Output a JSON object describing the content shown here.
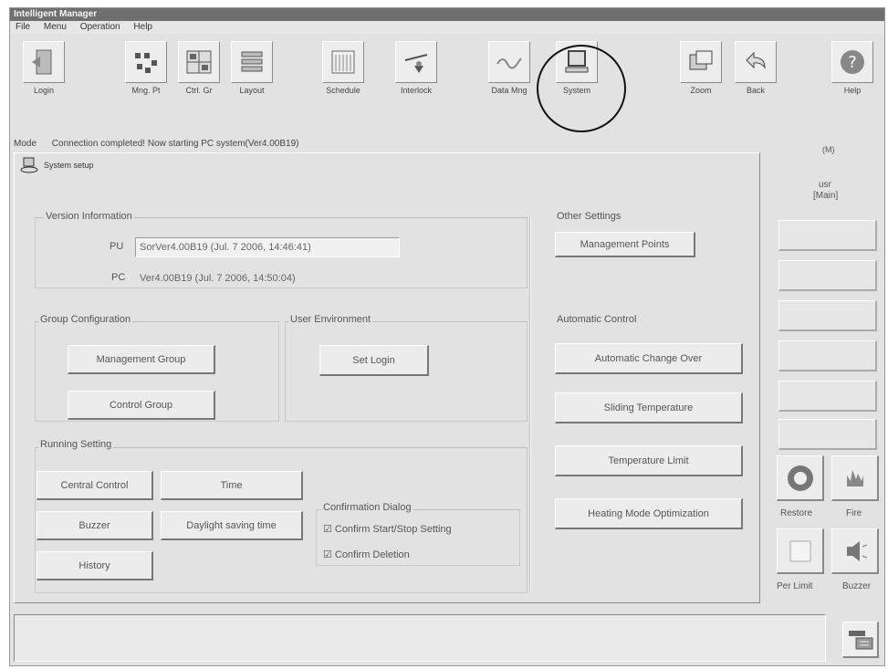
{
  "window": {
    "title": "Intelligent Manager"
  },
  "menu": [
    "File",
    "Menu",
    "Operation",
    "Help"
  ],
  "toolbar": [
    {
      "label": "Login",
      "icon": "door-icon"
    },
    {
      "label": "Mng. Pt",
      "icon": "network-icon"
    },
    {
      "label": "Ctrl. Gr",
      "icon": "grid-icon"
    },
    {
      "label": "Layout",
      "icon": "layers-icon"
    },
    {
      "label": "Schedule",
      "icon": "calendar-icon"
    },
    {
      "label": "Interlock",
      "icon": "interlock-icon"
    },
    {
      "label": "Data Mng",
      "icon": "wave-icon"
    },
    {
      "label": "System",
      "icon": "monitor-icon"
    },
    {
      "label": "Zoom",
      "icon": "zoom-icon"
    },
    {
      "label": "Back",
      "icon": "back-arrow-icon"
    },
    {
      "label": "Help",
      "icon": "help-icon"
    }
  ],
  "status": {
    "mode_label": "Mode",
    "message": "Connection completed! Now starting PC system(Ver4.00B19)",
    "right_info": "(M)"
  },
  "main": {
    "header": "System setup",
    "version": {
      "title": "Version Information",
      "pu_label": "PU",
      "pu_value": "SorVer4.00B19 (Jul. 7 2006, 14:46:41)",
      "pc_label": "PC",
      "pc_value": "Ver4.00B19 (Jul. 7 2006, 14:50:04)"
    },
    "other": {
      "title": "Other Settings",
      "management_points": "Management Points"
    },
    "group_config": {
      "title": "Group Configuration",
      "management_group": "Management Group",
      "control_group": "Control Group"
    },
    "user_env": {
      "title": "User Environment",
      "set_login": "Set Login"
    },
    "auto_control": {
      "title": "Automatic Control",
      "changeover": "Automatic Change Over",
      "sliding": "Sliding Temperature",
      "temp_limit": "Temperature Limit",
      "heating_opt": "Heating Mode Optimization"
    },
    "running": {
      "title": "Running Setting",
      "central_control": "Central Control",
      "time": "Time",
      "buzzer": "Buzzer",
      "daylight": "Daylight saving time",
      "history": "History"
    },
    "confirmation": {
      "title": "Confirmation Dialog",
      "opt1": "Confirm Start/Stop Setting",
      "opt2": "Confirm Deletion"
    }
  },
  "side": {
    "top_label": "(M)",
    "user_label": "usr",
    "user_value": "[Main]",
    "restore": "Restore",
    "fire": "Fire",
    "per_limit": "Per Limit",
    "buzzer": "Buzzer"
  },
  "colors": {
    "background": "#e2e2e2",
    "titlebar": "#6f6f6f"
  }
}
